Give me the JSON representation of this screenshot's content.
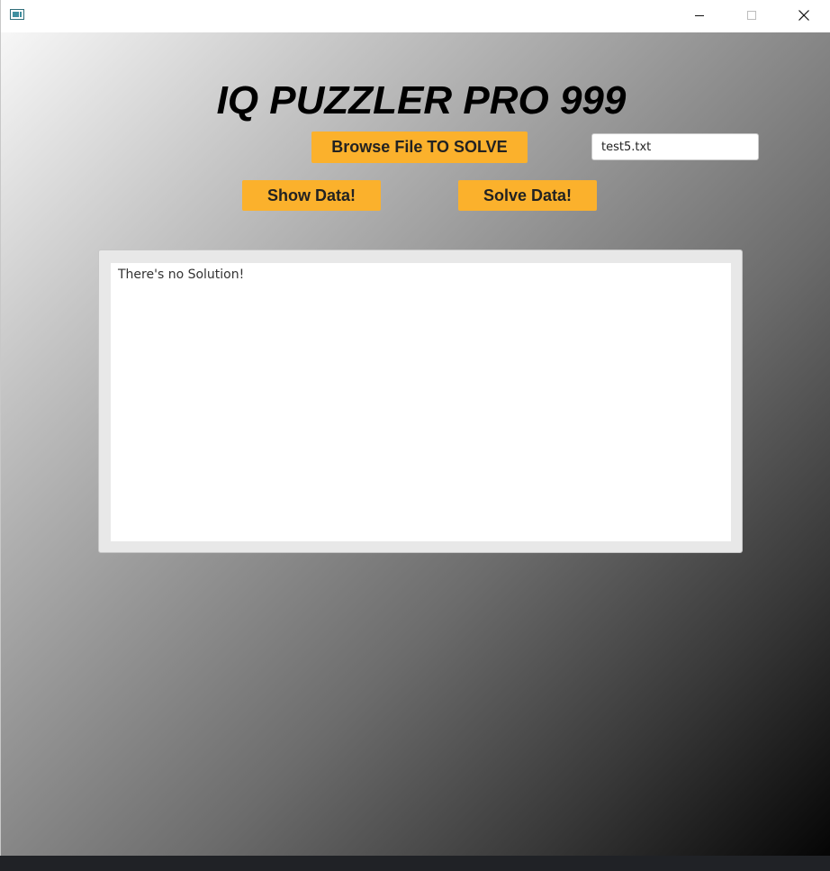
{
  "window": {
    "icon": "app-window-icon",
    "controls": {
      "minimize_icon": "minimize-icon",
      "maximize_icon": "maximize-icon",
      "close_icon": "close-icon"
    }
  },
  "main": {
    "title": "IQ PUZZLER PRO 999",
    "browse_label": "Browse File TO SOLVE",
    "file_name": "test5.txt",
    "show_label": "Show Data!",
    "solve_label": "Solve Data!",
    "output_text": "There's no Solution!"
  },
  "colors": {
    "button_accent": "#fbb12c",
    "background_light": "#f7f7f7",
    "background_dark": "#050505"
  }
}
